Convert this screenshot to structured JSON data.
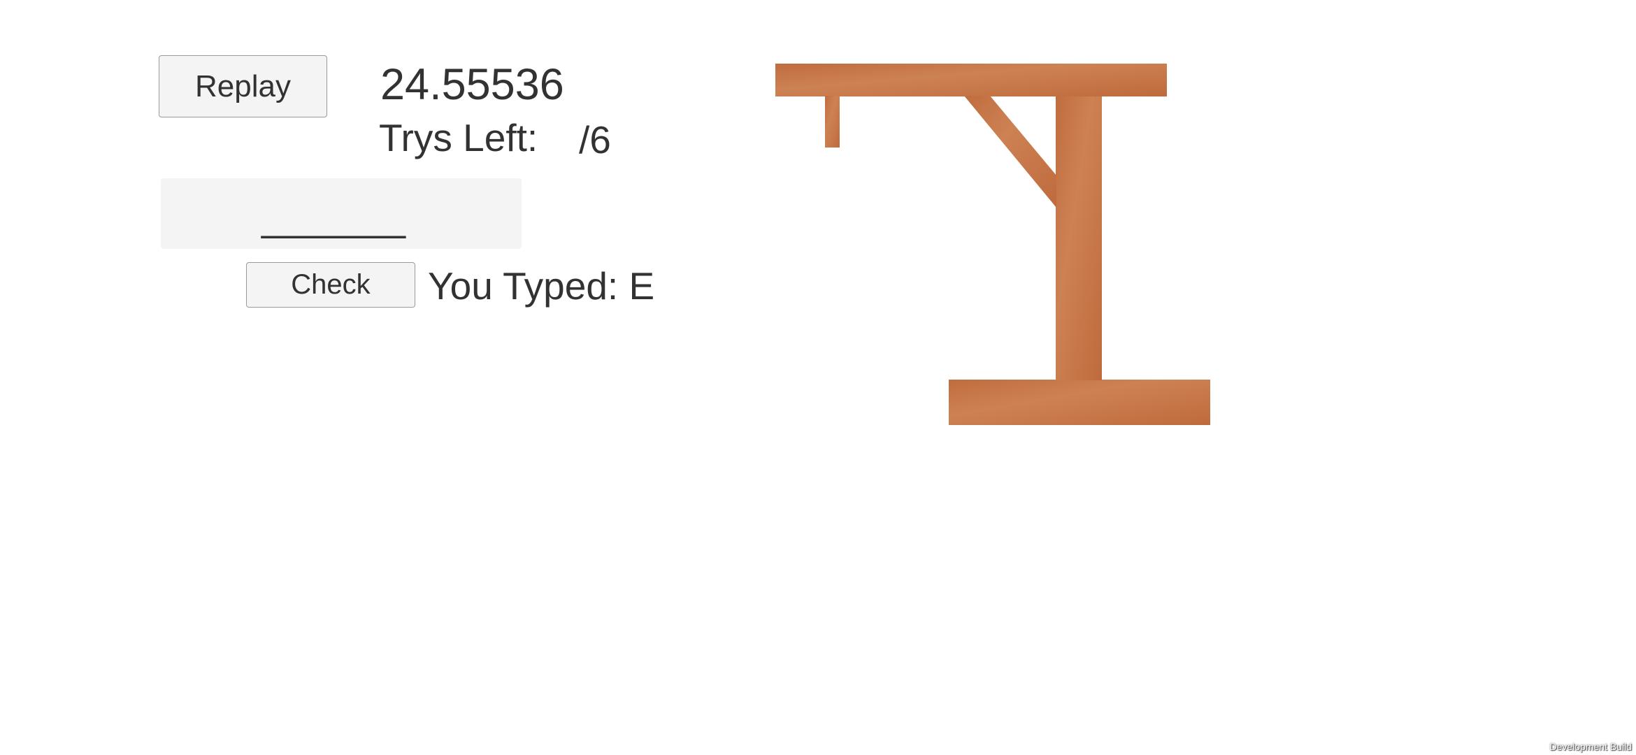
{
  "controls": {
    "replay_label": "Replay",
    "check_label": "Check"
  },
  "status": {
    "timer": "24.55536",
    "trys_left_label": "Trys Left:",
    "trys_left_value": "/6",
    "you_typed_label": "You Typed: E"
  },
  "word": {
    "masked": "_______"
  },
  "gallows": {
    "color": "#c8784a",
    "parts_shown": [
      "base",
      "post",
      "beam",
      "brace",
      "rope"
    ]
  },
  "footer": {
    "build_label": "Development Build"
  }
}
